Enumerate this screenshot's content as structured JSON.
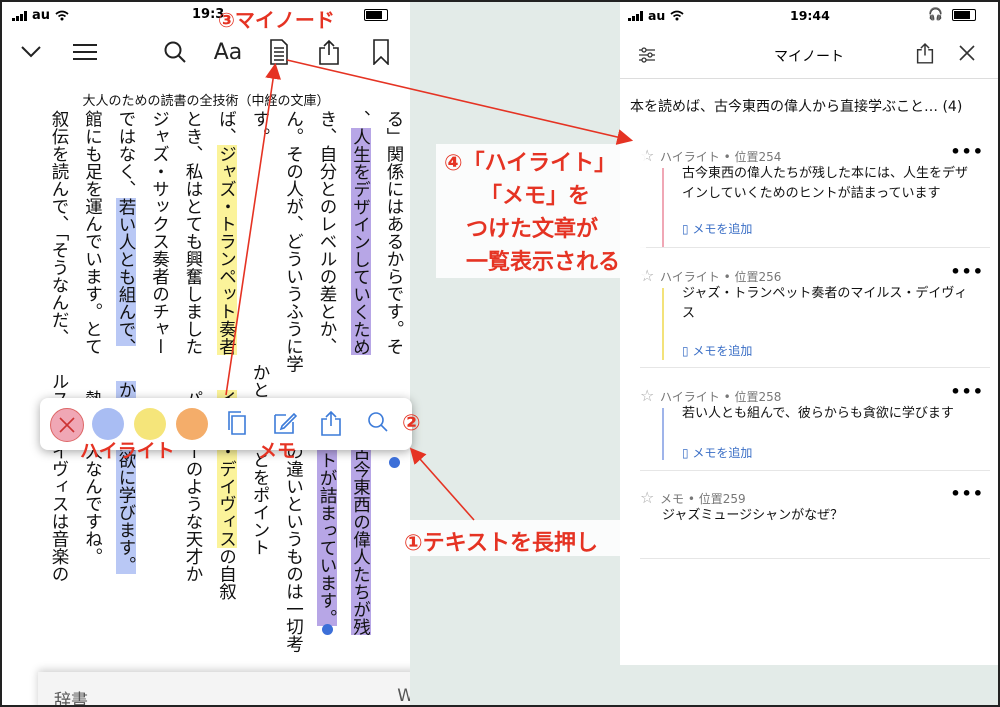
{
  "left": {
    "status": {
      "carrier": "au",
      "time": "19:3"
    },
    "book_title": "大人のための読書の全技術（中経の文庫）",
    "columns": [
      {
        "parts": [
          {
            "t": "る」関係にはあるからです。そ"
          }
        ]
      },
      {
        "parts": [
          {
            "t": "、"
          },
          {
            "t": "人生をデザインしていくため",
            "hl": "p"
          },
          {
            "t": "　　　　　"
          },
          {
            "t": "古今東西の偉人たちが残",
            "hl": "p"
          }
        ]
      },
      {
        "parts": [
          {
            "t": "き、自分とのレベルの差とか、"
          },
          {
            "t": "　　　　　"
          },
          {
            "t": "ントが詰まっています。",
            "hl": "p"
          }
        ]
      },
      {
        "parts": [
          {
            "t": "ん。その人が、どういうふうに学"
          },
          {
            "t": "　　　　"
          },
          {
            "t": "の違いというものは一切考"
          }
        ]
      },
      {
        "parts": [
          {
            "t": "す。"
          },
          {
            "t": "　　　　　　　　　　　　　"
          },
          {
            "t": "かということをポイント"
          }
        ]
      },
      {
        "parts": [
          {
            "t": "ば、"
          },
          {
            "t": "ジャズ・トランペット奏者",
            "hl": "y"
          },
          {
            "t": "　　"
          },
          {
            "t": "イルス・デイヴィス",
            "hl": "y"
          },
          {
            "t": "の自叙"
          }
        ]
      },
      {
        "parts": [
          {
            "t": "とき、私はとても興奮しました"
          },
          {
            "t": "　　"
          },
          {
            "t": "パーカーのような天才か"
          }
        ]
      },
      {
        "parts": [
          {
            "t": "ジャズ・サックス奏者のチャー"
          }
        ]
      },
      {
        "parts": [
          {
            "t": "ではなく、"
          },
          {
            "t": "若い人とも組んで、",
            "hl": "b"
          },
          {
            "t": "　　"
          },
          {
            "t": "からも貪欲に学びます。",
            "hl": "b"
          }
        ]
      },
      {
        "parts": [
          {
            "t": "館にも足を運んでいます。とて"
          },
          {
            "t": "　　"
          },
          {
            "t": "熱心な人なんですね。"
          }
        ]
      },
      {
        "parts": [
          {
            "t": "叙伝を読んで、「そうなんだ、"
          },
          {
            "t": "　　"
          },
          {
            "t": "ルス・デイヴィスは音楽の"
          }
        ]
      }
    ],
    "dictionary_label": "辞書",
    "dictionary_right": "W"
  },
  "right": {
    "status": {
      "carrier": "au",
      "time": "19:44"
    },
    "header_title": "マイノート",
    "book_line": "本を読めば、古今東西の偉人から直接学ぶこと…",
    "book_count": "(4)",
    "items": [
      {
        "meta": "ハイライト • 位置254",
        "text": "古今東西の偉人たちが残した本には、人生をデザインしていくためのヒントが詰まっています",
        "memo": "メモを追加",
        "color": "#f0a7b5"
      },
      {
        "meta": "ハイライト • 位置256",
        "text": "ジャズ・トランペット奏者のマイルス・デイヴィス",
        "memo": "メモを追加",
        "color": "#f3e27a"
      },
      {
        "meta": "ハイライト • 位置258",
        "text": "若い人とも組んで、彼らからも貪欲に学びます",
        "memo": "メモを追加",
        "color": "#9fb4ea"
      },
      {
        "meta": "メモ • 位置259",
        "text": "ジャズミュージシャンがなぜ？",
        "memo": "",
        "color": ""
      }
    ]
  },
  "annotations": {
    "a1": "①テキストを長押し",
    "a2": "②",
    "a3": "③マイノード",
    "a4_lines": [
      "④「ハイライト」",
      "「メモ」を",
      "つけた文章が",
      "一覧表示される"
    ],
    "highlight": "ハイライト",
    "memo": "メモ"
  },
  "colors": {
    "accent": "#e53323",
    "purple": "#b7a6e6",
    "yellow": "#fbf39a",
    "blue": "#b9c8f5"
  }
}
